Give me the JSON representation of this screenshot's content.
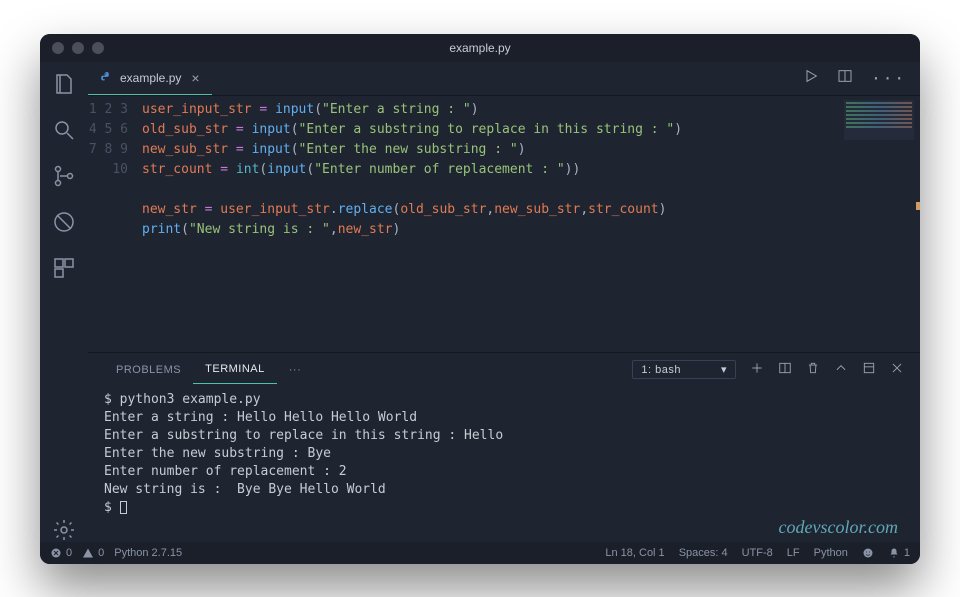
{
  "title": "example.py",
  "tab": {
    "label": "example.py"
  },
  "code": {
    "lines": [
      1,
      2,
      3,
      4,
      5,
      6,
      7,
      8,
      9,
      10
    ]
  },
  "editor": {
    "l1_var": "user_input_str",
    "l1_fn": "input",
    "l1_str": "\"Enter a string : \"",
    "l2_var": "old_sub_str",
    "l2_fn": "input",
    "l2_str": "\"Enter a substring to replace in this string : \"",
    "l3_var": "new_sub_str",
    "l3_fn": "input",
    "l3_str": "\"Enter the new substring : \"",
    "l4_var": "str_count",
    "l4_int": "int",
    "l4_fn": "input",
    "l4_str": "\"Enter number of replacement : \"",
    "l6_var": "new_str",
    "l6_src": "user_input_str",
    "l6_method": "replace",
    "l6_a": "old_sub_str",
    "l6_b": "new_sub_str",
    "l6_c": "str_count",
    "l7_fn": "print",
    "l7_str": "\"New string is : \"",
    "l7_arg": "new_str"
  },
  "panel": {
    "tabs": {
      "problems": "PROBLEMS",
      "terminal": "TERMINAL",
      "more": "···"
    },
    "shell_label": "1: bash"
  },
  "terminal": {
    "l1": "$ python3 example.py",
    "l2": "Enter a string : Hello Hello Hello World",
    "l3": "Enter a substring to replace in this string : Hello",
    "l4": "Enter the new substring : Bye",
    "l5": "Enter number of replacement : 2",
    "l6": "New string is :  Bye Bye Hello World",
    "l7": "$ "
  },
  "watermark": "codevscolor.com",
  "status": {
    "errors": "0",
    "warnings": "0",
    "python": "Python 2.7.15",
    "pos": "Ln 18, Col 1",
    "spaces": "Spaces: 4",
    "encoding": "UTF-8",
    "eol": "LF",
    "lang": "Python",
    "bell": "1"
  }
}
